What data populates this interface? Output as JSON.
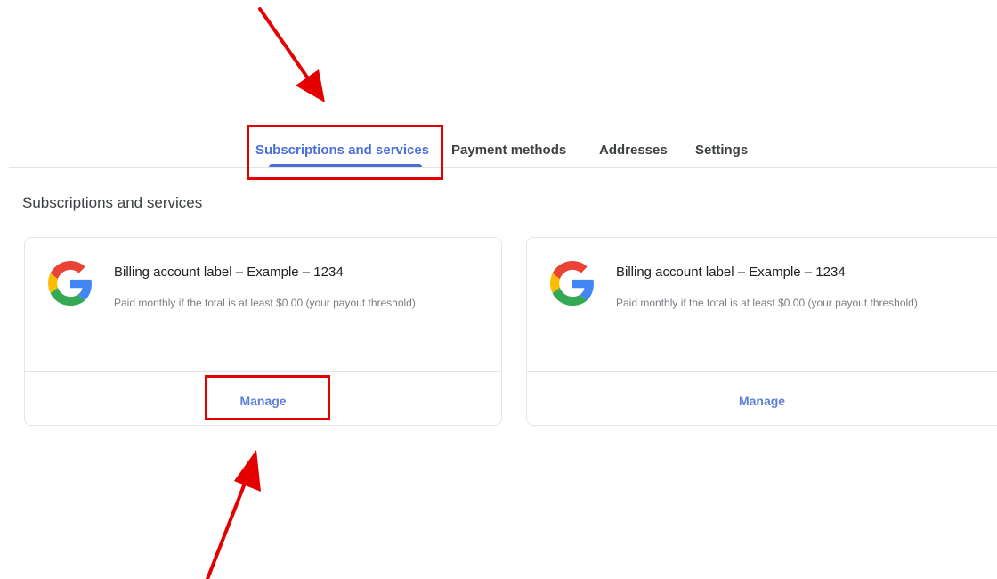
{
  "tabs": [
    {
      "label": "Subscriptions and services",
      "active": true
    },
    {
      "label": "Payment methods",
      "active": false
    },
    {
      "label": "Addresses",
      "active": false
    },
    {
      "label": "Settings",
      "active": false
    }
  ],
  "section_title": "Subscriptions and services",
  "cards": [
    {
      "logo": "google-g-icon",
      "title": "Billing account label – Example – 1234",
      "subtitle": "Paid monthly if the total is at least $0.00 (your payout threshold)",
      "action_label": "Manage"
    },
    {
      "logo": "google-g-icon",
      "title": "Billing account label – Example – 1234",
      "subtitle": "Paid monthly if the total is at least $0.00 (your payout threshold)",
      "action_label": "Manage"
    }
  ],
  "annotation_color": "#e50000",
  "accent_color": "#4a70d8"
}
